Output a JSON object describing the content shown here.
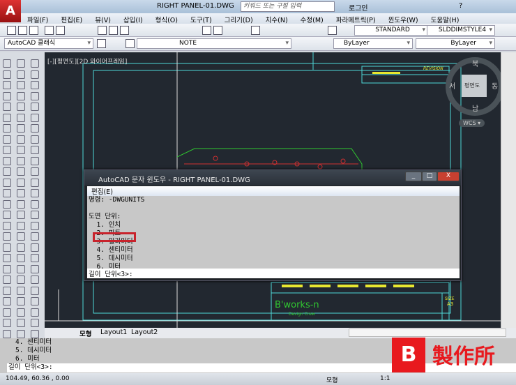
{
  "app": {
    "logo": "A",
    "doc_title": "RIGHT PANEL-01.DWG",
    "search_placeholder": "키워드 또는 구절 입력",
    "login": "로그인",
    "help": "?"
  },
  "menu": [
    "파일(F)",
    "편집(E)",
    "뷰(V)",
    "삽입(I)",
    "형식(O)",
    "도구(T)",
    "그리기(D)",
    "치수(N)",
    "수정(M)",
    "파라메트릭(P)",
    "윈도우(W)",
    "도움말(H)"
  ],
  "toolbar": {
    "text_style": "STANDARD",
    "dim_style": "SLDDIMSTYLE4",
    "workspace": "AutoCAD 클래식",
    "layer": "NOTE",
    "color": "ByLayer",
    "linetype": "ByLayer"
  },
  "viewport": {
    "label": "[-][평면도][2D 와이어프레임]",
    "compass": {
      "north": "북",
      "south": "남",
      "east": "동",
      "west": "서",
      "center": "평면도"
    },
    "ucs": "WCS ▾",
    "title_block": {
      "revision": "REVISION",
      "brand": "B'works-n",
      "brand_sub": "Design Crew",
      "size": "SIZE",
      "size_val": "A3"
    },
    "colors": {
      "cyan": "#4fd8d8",
      "yellow": "#e8e830",
      "green": "#30c830",
      "red": "#d03030"
    }
  },
  "tabs": [
    "모형",
    "Layout1",
    "Layout2"
  ],
  "text_window": {
    "title": "AutoCAD 문자 윈도우 - RIGHT PANEL-01.DWG",
    "menu": "편집(E)",
    "lines": [
      "명령: -DWGUNITS",
      "",
      "도면 단위:",
      "  1. 인치",
      "  2. 피트",
      "  3. 밀리미터",
      "  4. 센티미터",
      "  5. 데시미터",
      "  6. 미터"
    ],
    "prompt": "길이 단위<3>:",
    "highlight_color": "#c8232c"
  },
  "command": {
    "lines": [
      "4. 센티미터",
      "5. 데시미터",
      "6. 미터"
    ],
    "prompt": "길이 단위<3>:"
  },
  "status": {
    "coords": "104.49, 60.36 , 0.00",
    "model": "모형",
    "scale": "1:1"
  },
  "watermark": {
    "logo": "B",
    "text": "製作所"
  }
}
